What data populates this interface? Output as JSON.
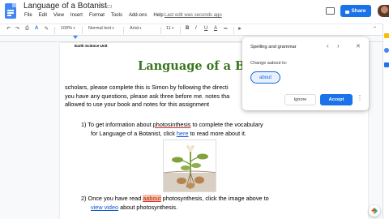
{
  "app": {
    "doc_title": "Language of a Botanist",
    "menu": [
      "File",
      "Edit",
      "View",
      "Insert",
      "Format",
      "Tools",
      "Add-ons",
      "Help"
    ],
    "last_edit": "Last edit was seconds ago",
    "share_label": "Share"
  },
  "toolbar": {
    "zoom": "100%",
    "style": "Normal text",
    "font": "Arial",
    "font_size": "11"
  },
  "document": {
    "header": "Earth Science Unit",
    "heading": "Language of a Botanist",
    "intro_lines": [
      "scholars, please complete this is Simon by following the directi",
      "you have any questions, please ask three before me. notes tha",
      "allowed to use your book and notes for this assignment"
    ],
    "item1": {
      "number": "1)",
      "line1_pre": "To get information about ",
      "line1_word": "photosinthesis",
      "line1_post": " to complete the vocabulary",
      "line2_pre": "for Language of a Botanist, click ",
      "line2_link": "here",
      "line2_post": " to read more about it."
    },
    "item2": {
      "number": "2)",
      "line1_pre": "Once you have read ",
      "line1_error": "aabout",
      "line1_post": " photosynthesis, click the image above to",
      "line2_link": "view  video",
      "line2_post": " about photosynthesis."
    }
  },
  "spellcheck": {
    "title": "Spelling and grammar",
    "change_label": "Change aabout to:",
    "suggestion": "about",
    "ignore_label": "Ignore",
    "accept_label": "Accept"
  },
  "colors": {
    "heading_green": "#38761d",
    "accent_blue": "#1a73e8",
    "error_highlight": "#f8c3a8",
    "link_blue": "#1155cc"
  }
}
